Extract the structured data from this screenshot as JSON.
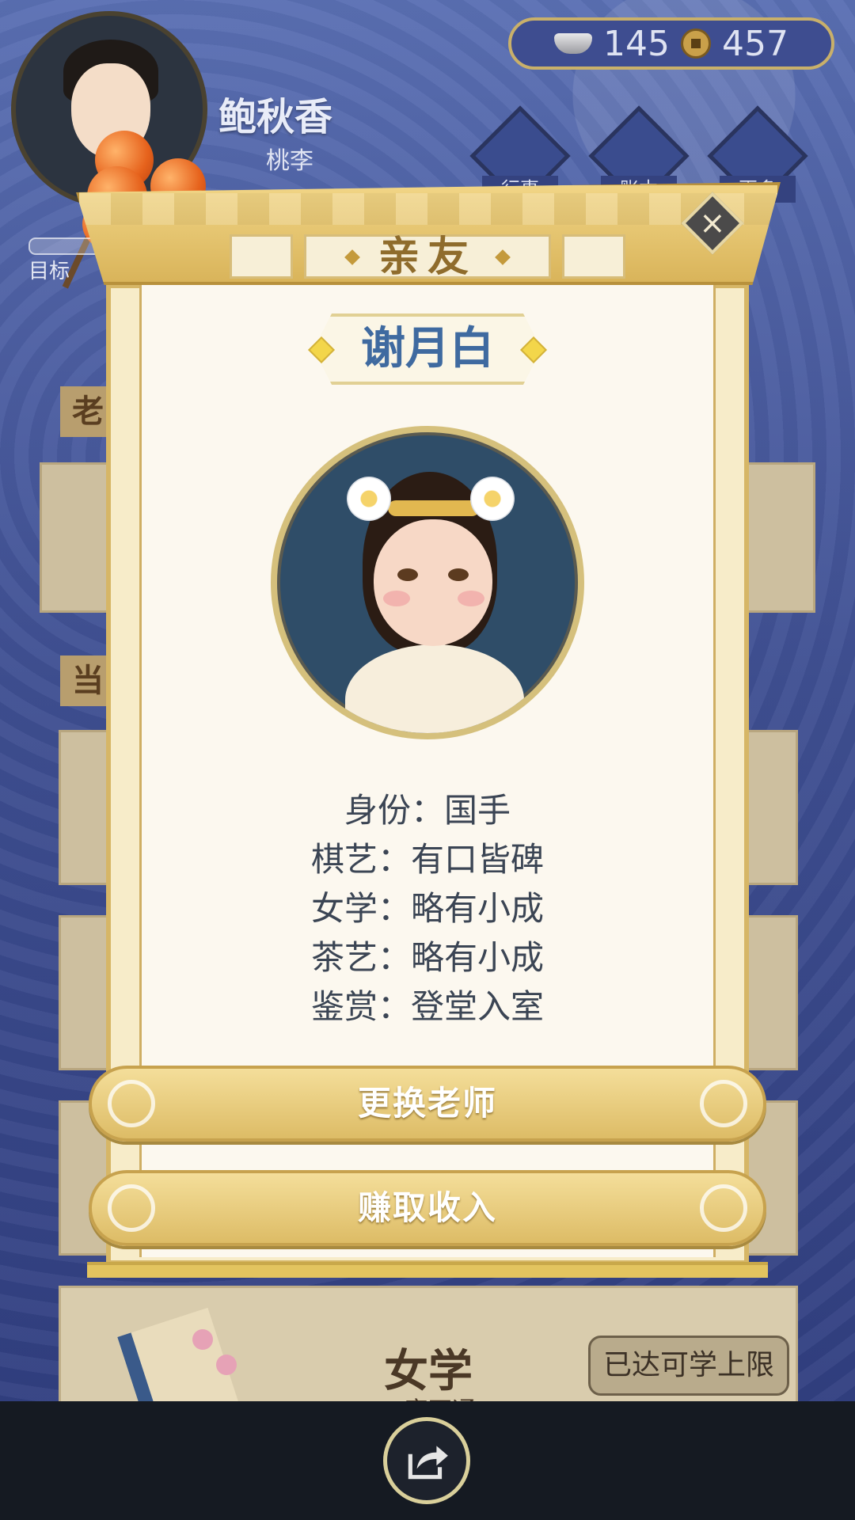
{
  "player": {
    "name": "鲍秋香",
    "subtitle": "桃李",
    "goal_label": "目标"
  },
  "currency": {
    "silver": "145",
    "coins": "457"
  },
  "top_menu": [
    {
      "label": "行事",
      "icon": "bow-icon"
    },
    {
      "label": "账本",
      "icon": "book-icon"
    },
    {
      "label": "更多",
      "icon": "more-icon"
    }
  ],
  "background": {
    "tab1": "老",
    "tab2": "当"
  },
  "modal": {
    "title": "亲友",
    "name": "谢月白",
    "stats": [
      "身份：国手",
      "棋艺：有口皆碑",
      "女学：略有小成",
      "茶艺：略有小成",
      "鉴赏：登堂入室"
    ],
    "buttons": {
      "change_teacher": "更换老师",
      "earn_income": "赚取收入"
    }
  },
  "bottom_card": {
    "title": "女学",
    "subtitle": "一窍不通",
    "limit_button": "已达可学上限"
  },
  "colors": {
    "background": "#3d4e93",
    "gold": "#ddbc66",
    "name_blue": "#3f6aa0",
    "text_dark": "#3b4554"
  }
}
